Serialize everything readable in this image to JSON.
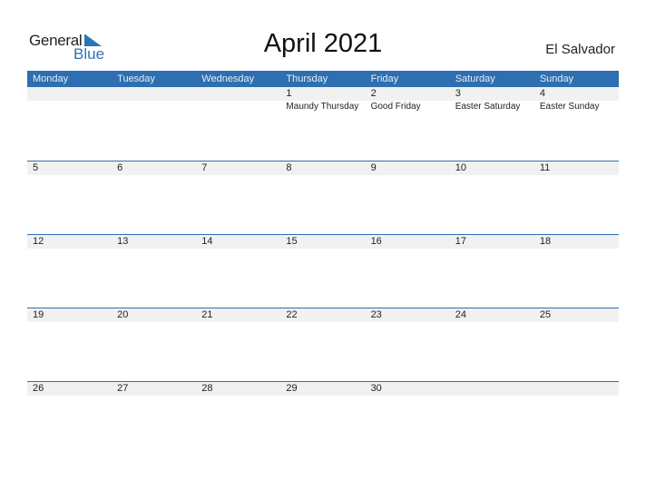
{
  "logo": {
    "line1": "General",
    "line2": "Blue"
  },
  "title": "April 2021",
  "country": "El Salvador",
  "colors": {
    "accent": "#2d6fb0",
    "band": "#f1f1f1"
  },
  "weekdays": [
    "Monday",
    "Tuesday",
    "Wednesday",
    "Thursday",
    "Friday",
    "Saturday",
    "Sunday"
  ],
  "weeks": [
    {
      "days": [
        "",
        "",
        "",
        "1",
        "2",
        "3",
        "4"
      ],
      "holidays": [
        "",
        "",
        "",
        "Maundy Thursday",
        "Good Friday",
        "Easter Saturday",
        "Easter Sunday"
      ]
    },
    {
      "days": [
        "5",
        "6",
        "7",
        "8",
        "9",
        "10",
        "11"
      ],
      "holidays": [
        "",
        "",
        "",
        "",
        "",
        "",
        ""
      ]
    },
    {
      "days": [
        "12",
        "13",
        "14",
        "15",
        "16",
        "17",
        "18"
      ],
      "holidays": [
        "",
        "",
        "",
        "",
        "",
        "",
        ""
      ]
    },
    {
      "days": [
        "19",
        "20",
        "21",
        "22",
        "23",
        "24",
        "25"
      ],
      "holidays": [
        "",
        "",
        "",
        "",
        "",
        "",
        ""
      ]
    },
    {
      "days": [
        "26",
        "27",
        "28",
        "29",
        "30",
        "",
        ""
      ],
      "holidays": [
        "",
        "",
        "",
        "",
        "",
        "",
        ""
      ]
    }
  ]
}
